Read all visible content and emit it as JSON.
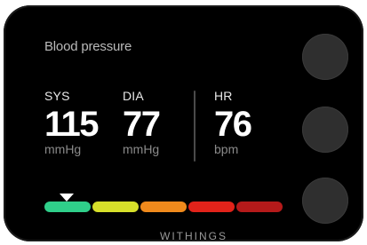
{
  "screen": {
    "title": "Blood pressure",
    "brand": "WITHINGS"
  },
  "metrics": {
    "sys": {
      "label": "SYS",
      "value": "115",
      "unit": "mmHg"
    },
    "dia": {
      "label": "DIA",
      "value": "77",
      "unit": "mmHg"
    },
    "hr": {
      "label": "HR",
      "value": "76",
      "unit": "bpm"
    }
  },
  "scale": {
    "segments": [
      {
        "name": "normal",
        "color": "#2fcf8a"
      },
      {
        "name": "elevated",
        "color": "#d7e02a"
      },
      {
        "name": "stage-1",
        "color": "#f08a1c"
      },
      {
        "name": "stage-2",
        "color": "#e2231a"
      },
      {
        "name": "crisis",
        "color": "#b51a1a"
      }
    ],
    "selected_segment": "normal",
    "pointer_icon": "triangle-down-icon"
  },
  "buttons": [
    {
      "name": "top-button"
    },
    {
      "name": "middle-button"
    },
    {
      "name": "bottom-button"
    }
  ]
}
